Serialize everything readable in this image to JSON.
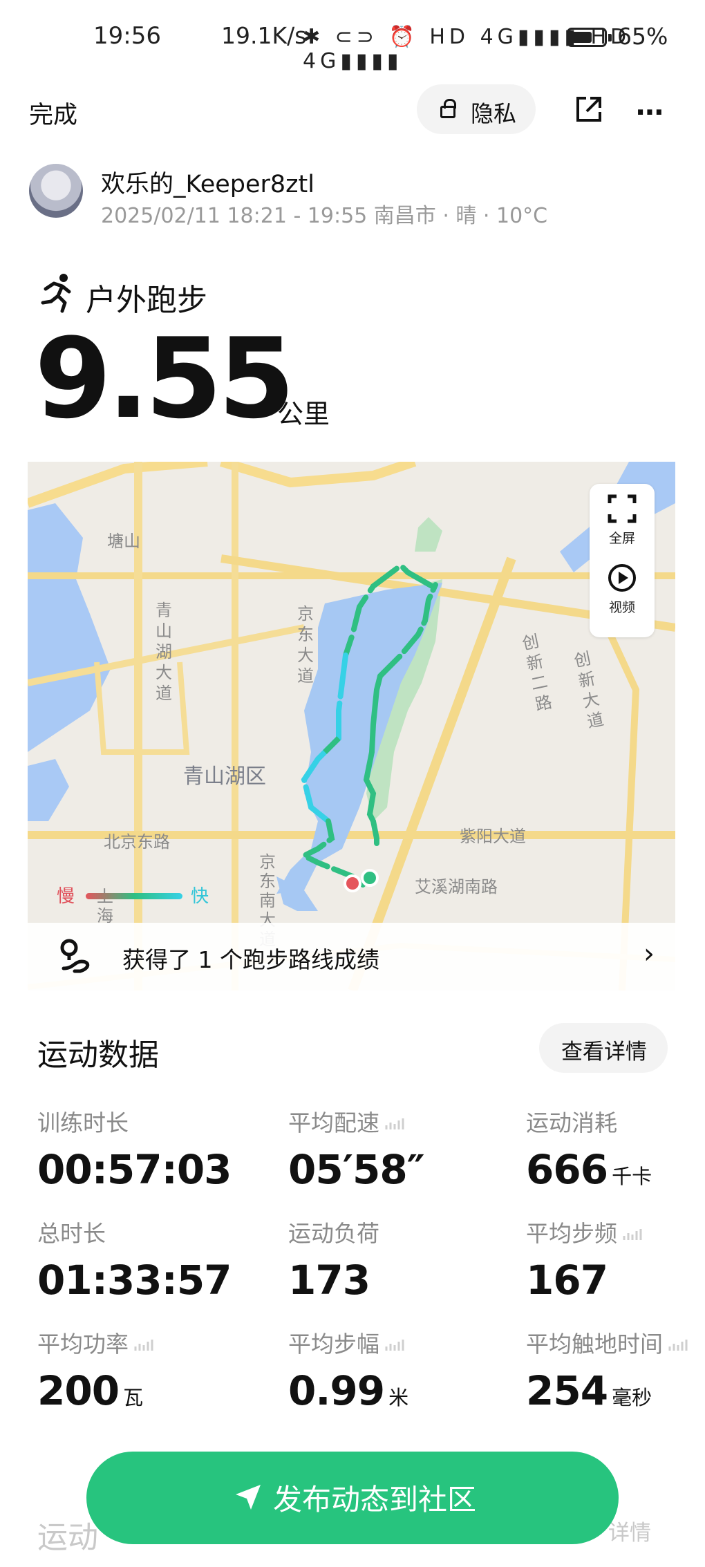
{
  "status_bar": {
    "time": "19:56",
    "network_speed": "19.1K/s",
    "icons_text": "✱ ⊂⊃ ⏰ HD 4G▮▮▮▮ HD 4G▮▮▮▮",
    "battery_pct": "65%",
    "battery_level": 0.65
  },
  "nav": {
    "done_label": "完成",
    "privacy_label": "隐私",
    "share_icon": "share-icon",
    "more_icon": "⋯"
  },
  "user": {
    "name": "欢乐的_Keeper8ztl",
    "meta": "2025/02/11 18:21 - 19:55 南昌市 · 晴 · 10°C"
  },
  "activity": {
    "type": "户外跑步",
    "distance": "9.55",
    "distance_unit": "公里"
  },
  "map": {
    "fullscreen_label": "全屏",
    "video_label": "视频",
    "legend_slow": "慢",
    "legend_fast": "快",
    "labels": {
      "tangshan": "塘山",
      "qingshanhu_dadao": "青山湖大道",
      "jingdong_dadao": "京东大道",
      "chuangxin_er_lu": "创新二路",
      "chuangxin_da_dao": "创新大道",
      "qingshanhu_qu": "青山湖区",
      "beijing_dong_lu": "北京东路",
      "ziyang_da_dao": "紫阳大道",
      "jingdong_nan_da_dao": "京东南大道",
      "aixi_hu_nan_lu": "艾溪湖南路",
      "shanghai": "上海"
    },
    "achievement": "获得了 1 个跑步路线成绩"
  },
  "stats": {
    "title": "运动数据",
    "detail_button": "查看详情",
    "items": [
      {
        "label": "训练时长",
        "value": "00:57:03",
        "unit": ""
      },
      {
        "label": "平均配速",
        "value": "05′58″",
        "unit": ""
      },
      {
        "label": "运动消耗",
        "value": "666",
        "unit": "千卡"
      },
      {
        "label": "总时长",
        "value": "01:33:57",
        "unit": ""
      },
      {
        "label": "运动负荷",
        "value": "173",
        "unit": ""
      },
      {
        "label": "平均步频",
        "value": "167",
        "unit": ""
      },
      {
        "label": "平均功率",
        "value": "200",
        "unit": "瓦"
      },
      {
        "label": "平均步幅",
        "value": "0.99",
        "unit": "米"
      },
      {
        "label": "平均触地时间",
        "value": "254",
        "unit": "毫秒"
      }
    ]
  },
  "cta": {
    "label": "发布动态到社区"
  },
  "next_section": {
    "title_partial": "运动",
    "detail_partial": "详情"
  },
  "colors": {
    "accent": "#27c47e",
    "route_fast": "#36d1e6",
    "route_slow": "#e5555c"
  }
}
